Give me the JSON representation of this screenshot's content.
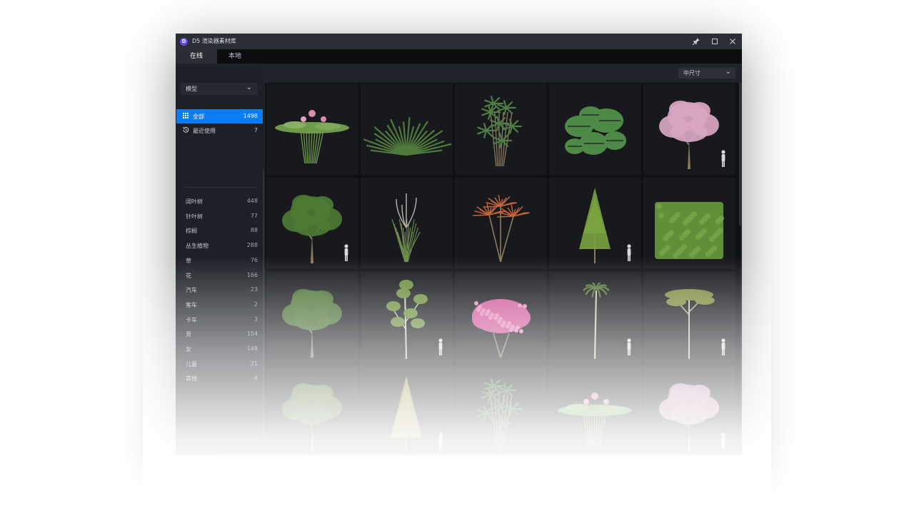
{
  "window": {
    "title": "D5 渲染器素材库",
    "logo": "D",
    "controls": [
      "pin-icon",
      "maximize-icon",
      "close-icon"
    ]
  },
  "tabs": [
    {
      "label": "在线",
      "active": true
    },
    {
      "label": "本地",
      "active": false
    }
  ],
  "sidebar": {
    "type_select": "模型",
    "nav": [
      {
        "label": "全部",
        "count": "1498",
        "icon": "grid-icon",
        "active": true
      },
      {
        "label": "最近使用",
        "count": "7",
        "icon": "history-icon",
        "active": false
      }
    ],
    "categories": [
      {
        "label": "阔叶树",
        "count": "448"
      },
      {
        "label": "针叶树",
        "count": "77"
      },
      {
        "label": "棕榈",
        "count": "88"
      },
      {
        "label": "丛生植物",
        "count": "288"
      },
      {
        "label": "草",
        "count": "76"
      },
      {
        "label": "花",
        "count": "166"
      },
      {
        "label": "汽车",
        "count": "23"
      },
      {
        "label": "客车",
        "count": "2"
      },
      {
        "label": "卡车",
        "count": "3"
      },
      {
        "label": "男",
        "count": "154"
      },
      {
        "label": "女",
        "count": "148"
      },
      {
        "label": "儿童",
        "count": "21"
      },
      {
        "label": "其他",
        "count": "4"
      }
    ]
  },
  "toolbar": {
    "size_select": "中尺寸"
  },
  "assets": [
    {
      "name": "water-lily-thumbnail",
      "kind": "lily",
      "color": "#6f9a4c",
      "human": false
    },
    {
      "name": "yucca-thumbnail",
      "kind": "spiky",
      "color": "#4f7a3c",
      "human": false
    },
    {
      "name": "lady-palm-thumbnail",
      "kind": "palmbush",
      "color": "#4f7d45",
      "human": false
    },
    {
      "name": "monstera-thumbnail",
      "kind": "monstera",
      "color": "#4c8a46",
      "human": false
    },
    {
      "name": "cherry-blossom-tree-thumbnail",
      "kind": "tree",
      "color": "#d9a6c2",
      "human": true
    },
    {
      "name": "broadleaf-tree-thumbnail",
      "kind": "tree",
      "color": "#4d7a33",
      "human": true
    },
    {
      "name": "pampas-grass-thumbnail",
      "kind": "grass",
      "color": "#6d8d4f",
      "human": false
    },
    {
      "name": "red-cordyline-thumbnail",
      "kind": "cordyline",
      "color": "#c8663a",
      "human": false
    },
    {
      "name": "conifer-tree-thumbnail",
      "kind": "conifer",
      "color": "#7aa33f",
      "human": true
    },
    {
      "name": "hedge-thumbnail",
      "kind": "hedge",
      "color": "#5f8f38",
      "human": false
    },
    {
      "name": "round-shrub-tree-thumbnail",
      "kind": "tree",
      "color": "#4e7536",
      "human": false
    },
    {
      "name": "birch-tree-thumbnail",
      "kind": "sparse",
      "color": "#6c8f3c",
      "human": true
    },
    {
      "name": "azalea-bush-thumbnail",
      "kind": "bush",
      "color": "#d05a9a",
      "human": false
    },
    {
      "name": "tall-palm-thumbnail",
      "kind": "palm",
      "color": "#5a7a37",
      "human": true
    },
    {
      "name": "acacia-tree-thumbnail",
      "kind": "umbrella",
      "color": "#7d8a3e",
      "human": true
    },
    {
      "name": "oak-tree-thumbnail",
      "kind": "tree",
      "color": "#556d33",
      "human": false
    },
    {
      "name": "golden-conifer-thumbnail",
      "kind": "conifer",
      "color": "#a89a55",
      "human": true
    },
    {
      "name": "banana-plant-thumbnail",
      "kind": "palmbush",
      "color": "#3f6b35",
      "human": false
    },
    {
      "name": "lotus-pond-thumbnail",
      "kind": "lily",
      "color": "#6f9a4c",
      "human": false
    },
    {
      "name": "flowering-tree-thumbnail",
      "kind": "tree",
      "color": "#c49ab4",
      "human": true
    }
  ]
}
